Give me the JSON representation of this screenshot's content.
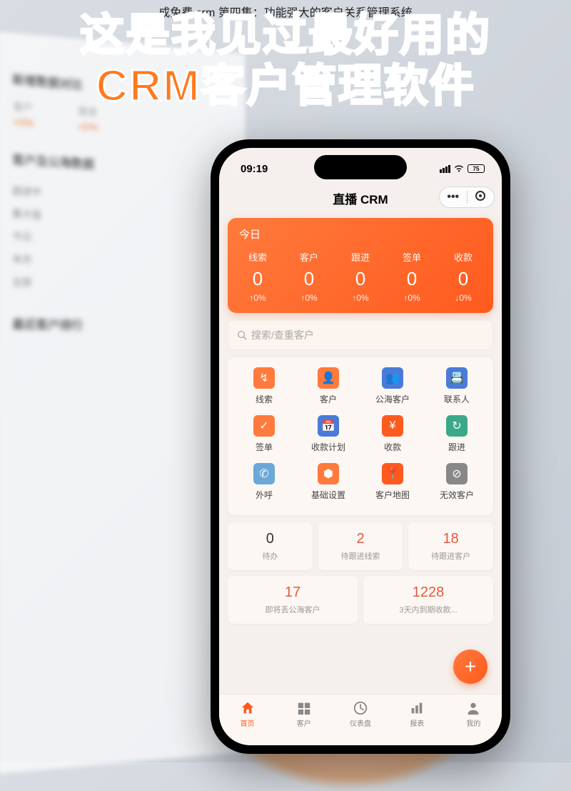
{
  "caption": "成免费 crm 第四集：功能强大的客户关系管理系统",
  "headline_line1": "这是我见过最好用的",
  "headline_line2": "CRM客户管理软件",
  "bg_monitor": {
    "section1_title": "新增数据对比",
    "cols": [
      {
        "label": "客户",
        "val": "+0%"
      },
      {
        "label": "跟进",
        "val": "+0%"
      }
    ],
    "section2_title": "客户及公海数据",
    "list": [
      "跟进中",
      "最大值",
      "今日",
      "本月",
      "全部"
    ],
    "section3_title": "最近客户排行"
  },
  "status": {
    "time": "09:19",
    "battery": "75"
  },
  "mp": {
    "title": "直播 CRM"
  },
  "today": {
    "header": "今日",
    "stats": [
      {
        "label": "线索",
        "value": "0",
        "delta": "↑0%"
      },
      {
        "label": "客户",
        "value": "0",
        "delta": "↑0%"
      },
      {
        "label": "跟进",
        "value": "0",
        "delta": "↑0%"
      },
      {
        "label": "签单",
        "value": "0",
        "delta": "↑0%"
      },
      {
        "label": "收款",
        "value": "0",
        "delta": "↓0%"
      }
    ]
  },
  "search": {
    "placeholder": "搜索/查重客户"
  },
  "grid": [
    {
      "label": "线索",
      "color": "#ff7a3c",
      "glyph": "↯"
    },
    {
      "label": "客户",
      "color": "#ff7a3c",
      "glyph": "👤"
    },
    {
      "label": "公海客户",
      "color": "#4a7bd8",
      "glyph": "👥"
    },
    {
      "label": "联系人",
      "color": "#4a7bd8",
      "glyph": "📇"
    },
    {
      "label": "签单",
      "color": "#ff7a3c",
      "glyph": "✓"
    },
    {
      "label": "收款计划",
      "color": "#4a7bd8",
      "glyph": "📅"
    },
    {
      "label": "收款",
      "color": "#ff5a1e",
      "glyph": "¥"
    },
    {
      "label": "跟进",
      "color": "#3ca88a",
      "glyph": "↻"
    },
    {
      "label": "外呼",
      "color": "#6aa8d8",
      "glyph": "✆"
    },
    {
      "label": "基础设置",
      "color": "#ff7a3c",
      "glyph": "⬢"
    },
    {
      "label": "客户地图",
      "color": "#ff5a1e",
      "glyph": "📍"
    },
    {
      "label": "无效客户",
      "color": "#888",
      "glyph": "⊘"
    }
  ],
  "kpis_row1": [
    {
      "num": "0",
      "label": "待办",
      "color": "#333"
    },
    {
      "num": "2",
      "label": "待跟进线索",
      "color": "#e05a3c"
    },
    {
      "num": "18",
      "label": "待跟进客户",
      "color": "#e05a3c"
    }
  ],
  "kpis_row2": [
    {
      "num": "17",
      "label": "即将丢公海客户",
      "color": "#e05a3c"
    },
    {
      "num": "1228",
      "label": "3天内到期收款...",
      "color": "#e05a3c"
    }
  ],
  "fab": "+",
  "tabs": [
    {
      "label": "首页",
      "active": true
    },
    {
      "label": "客户",
      "active": false
    },
    {
      "label": "仪表盘",
      "active": false
    },
    {
      "label": "报表",
      "active": false
    },
    {
      "label": "我的",
      "active": false
    }
  ]
}
